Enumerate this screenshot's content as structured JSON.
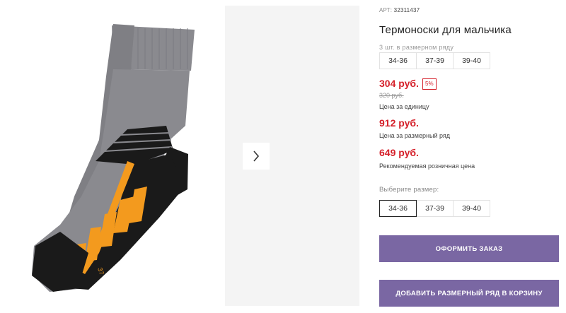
{
  "product": {
    "art_label": "АРТ:",
    "art_number": "32311437",
    "title": "Термоноски для мальчика",
    "pack_note": "3 шт. в размерном ряду",
    "pack_sizes": [
      "34-36",
      "37-39",
      "39-40"
    ]
  },
  "prices": {
    "unit_price": "304 руб.",
    "discount": "5%",
    "old_price": "320 руб.",
    "unit_caption": "Цена за единицу",
    "row_price": "912 руб.",
    "row_caption": "Цена за размерный ряд",
    "retail_price": "649 руб.",
    "retail_caption": "Рекомендуемая розничная цена"
  },
  "size_select": {
    "label": "Выберите размер:",
    "options": [
      "34-36",
      "37-39",
      "39-40"
    ],
    "selected": "34-36"
  },
  "actions": {
    "order_label": "ОФОРМИТЬ ЗАКАЗ",
    "add_row_label": "ДОБАВИТЬ РАЗМЕРНЫЙ РЯД В КОРЗИНУ"
  },
  "gallery": {
    "image_subject": "grey-black-orange-thermal-sock",
    "sock_size_mark": "37",
    "next_icon": "chevron-right-icon"
  },
  "colors": {
    "price_red": "#d5202a",
    "button_purple": "#7a67a3",
    "sock_grey": "#8a8a8f",
    "sock_black": "#1a1a1a",
    "sock_orange": "#f39a1e"
  }
}
